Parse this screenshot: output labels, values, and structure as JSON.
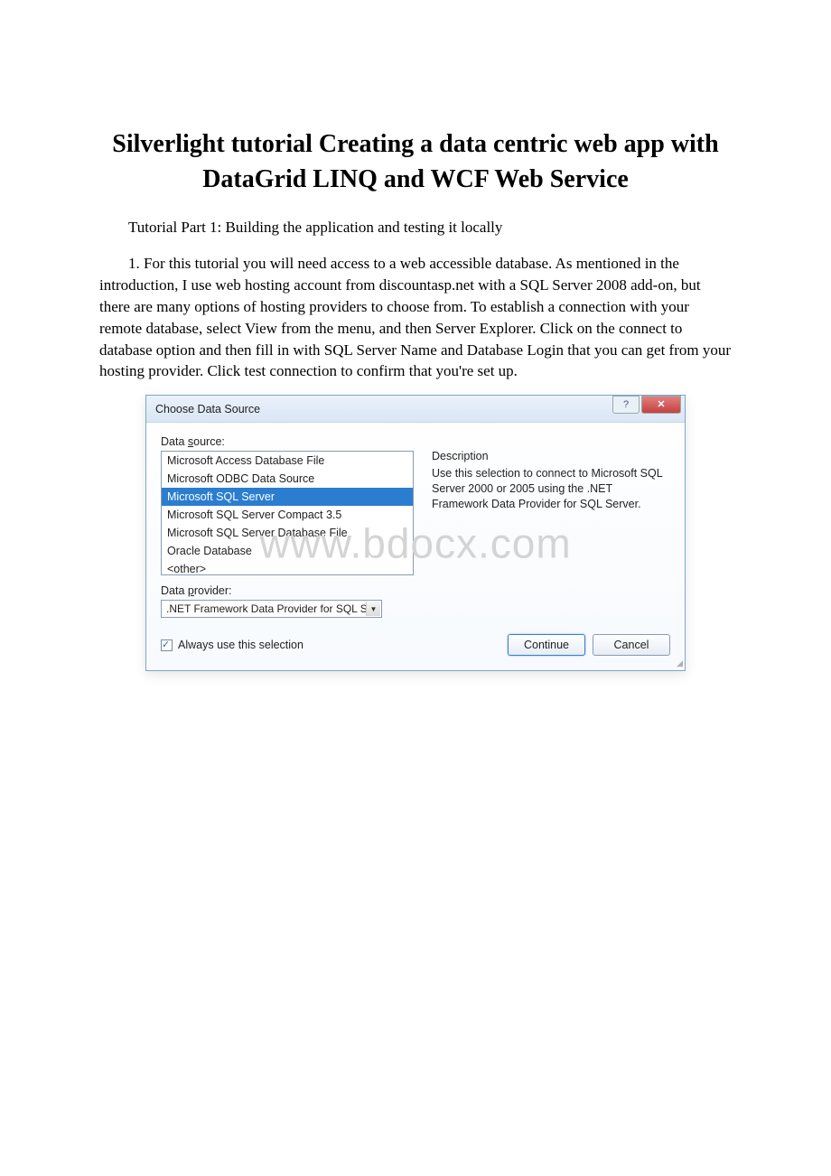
{
  "page": {
    "title": "Silverlight tutorial Creating a data centric web app with DataGrid LINQ and WCF Web Service",
    "subtitle": "Tutorial Part 1: Building the application and testing it locally",
    "paragraph1": "1. For this tutorial you will need access to a web accessible database.  As mentioned in the introduction, I use web hosting account from discountasp.net with a SQL Server 2008 add-on, but there are many options of hosting providers to choose from.  To establish a connection with your remote database, select View from the menu, and then Server Explorer.  Click on the connect to database option and then fill in with SQL Server Name and Database Login that you can get from your hosting provider. Click test connection to confirm that you're set up."
  },
  "watermark": "www.bdocx.com",
  "dialog": {
    "title": "Choose Data Source",
    "data_source_label_prefix": "Data ",
    "data_source_label_ul": "s",
    "data_source_label_suffix": "ource:",
    "items": [
      "Microsoft Access Database File",
      "Microsoft ODBC Data Source",
      "Microsoft SQL Server",
      "Microsoft SQL Server Compact 3.5",
      "Microsoft SQL Server Database File",
      "Oracle Database",
      "<other>"
    ],
    "selected_index": 2,
    "description_heading": "Description",
    "description_text": "Use this selection to connect to Microsoft SQL Server 2000 or 2005 using the .NET Framework Data Provider for SQL Server.",
    "provider_label_prefix": "Data ",
    "provider_label_ul": "p",
    "provider_label_suffix": "rovider:",
    "provider_value": ".NET Framework Data Provider for SQL S",
    "always_use_prefix": "Always ",
    "always_use_ul": "u",
    "always_use_suffix": "se this selection",
    "always_use_checked": true,
    "continue_label": "Continue",
    "cancel_label": "Cancel",
    "help_glyph": "?",
    "close_glyph": "✕"
  }
}
